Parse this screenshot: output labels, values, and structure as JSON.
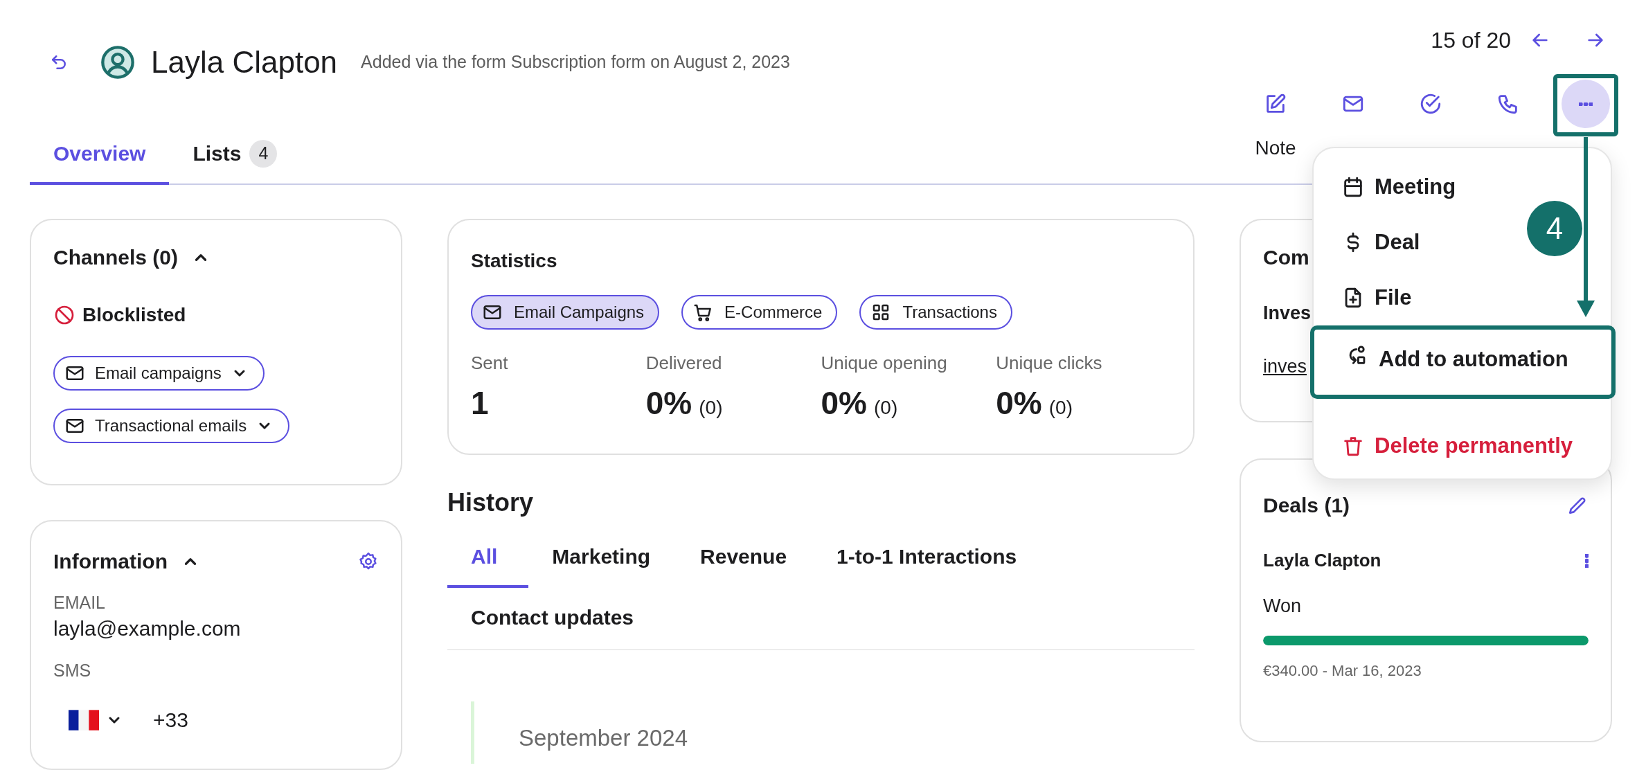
{
  "contact": {
    "name": "Layla Clapton",
    "subtitle": "Added via the form Subscription form on August 2, 2023"
  },
  "pagination": {
    "position": "15 of 20"
  },
  "actions": [
    {
      "label": "Note",
      "kind": "note",
      "selected": false,
      "highlighted": false
    },
    {
      "kind": "email",
      "selected": false,
      "highlighted": false
    },
    {
      "kind": "task",
      "selected": false,
      "highlighted": false
    },
    {
      "kind": "call",
      "selected": false,
      "highlighted": false
    },
    {
      "kind": "more",
      "selected": true,
      "highlighted": true
    }
  ],
  "tabs": [
    {
      "label": "Overview",
      "selected": true
    },
    {
      "label": "Lists",
      "count": "4",
      "selected": false
    }
  ],
  "channels": {
    "title": "Channels (0)",
    "expanded": true,
    "status": "Blocklisted",
    "subscriptions": [
      "Email campaigns",
      "Transactional emails"
    ]
  },
  "information": {
    "title": "Information",
    "expanded": true,
    "fields": [
      {
        "label": "EMAIL",
        "kind": "text",
        "value": "layla@example.com"
      },
      {
        "label": "SMS",
        "kind": "phone",
        "value": "+33"
      }
    ]
  },
  "statistics": {
    "title": "Statistics",
    "filters": [
      {
        "label": "Email Campaigns",
        "kind": "email",
        "selected": true
      },
      {
        "label": "E-Commerce",
        "kind": "cart",
        "selected": false
      },
      {
        "label": "Transactions",
        "kind": "grid",
        "selected": false
      }
    ],
    "metrics": [
      {
        "label": "Sent",
        "value": "1"
      },
      {
        "label": "Delivered",
        "value": "0%",
        "count": "(0)"
      },
      {
        "label": "Unique opening",
        "value": "0%",
        "count": "(0)"
      },
      {
        "label": "Unique clicks",
        "value": "0%",
        "count": "(0)"
      }
    ]
  },
  "history": {
    "title": "History",
    "tabs": [
      {
        "label": "All",
        "selected": true
      },
      {
        "label": "Marketing",
        "selected": false
      },
      {
        "label": "Revenue",
        "selected": false
      },
      {
        "label": "1-to-1 Interactions",
        "selected": false
      },
      {
        "label": "Contact updates",
        "selected": false
      }
    ],
    "timeline": [
      {
        "month": "September 2024"
      }
    ]
  },
  "companies": {
    "title": "Com",
    "name": "Inves",
    "link": "inves"
  },
  "deals": {
    "title": "Deals (1)",
    "items": [
      {
        "name": "Layla Clapton",
        "stage": "Won",
        "level": 1,
        "detail": "€340.00 - Mar 16, 2023"
      }
    ]
  },
  "more_menu": {
    "items": [
      {
        "label": "Meeting",
        "kind": "meeting",
        "highlighted": false
      },
      {
        "label": "Deal",
        "kind": "deal",
        "highlighted": false
      },
      {
        "label": "File",
        "kind": "file",
        "highlighted": false
      },
      {
        "label": "Add to automation",
        "kind": "automation",
        "highlighted": true
      },
      {
        "label": "Delete permanently",
        "kind": "delete",
        "highlighted": false
      }
    ]
  },
  "annotation": {
    "step": "4"
  }
}
